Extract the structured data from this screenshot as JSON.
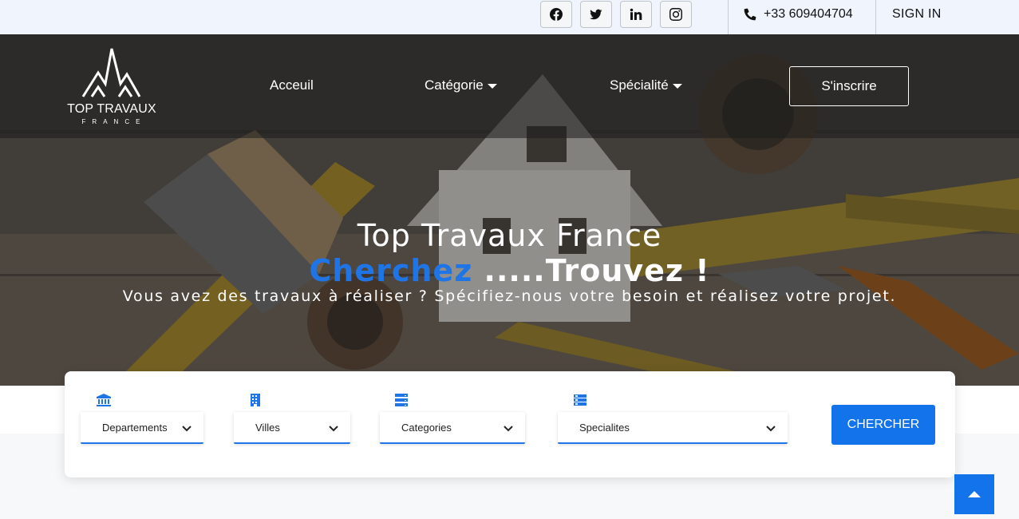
{
  "topbar": {
    "social": [
      {
        "name": "facebook-icon"
      },
      {
        "name": "twitter-icon"
      },
      {
        "name": "linkedin-icon"
      },
      {
        "name": "instagram-icon"
      }
    ],
    "phone": "+33 609404704",
    "signin": "SIGN IN"
  },
  "logo": {
    "main": "TOP TRAVAUX",
    "sub": "FRANCE"
  },
  "nav": {
    "home": "Acceuil",
    "category": "Catégorie",
    "specialty": "Spécialité",
    "signup": "S'inscrire"
  },
  "hero": {
    "title": "Top Travaux France",
    "tag_blue": "Cherchez",
    "tag_white": " .....Trouvez !",
    "subtitle": "Vous avez des travaux à réaliser ? Spécifiez-nous votre besoin et réalisez votre projet."
  },
  "search": {
    "departements": "Departements",
    "villes": "Villes",
    "categories": "Categories",
    "specialites": "Specialites",
    "button": "CHERCHER"
  },
  "colors": {
    "accent": "#1273eb",
    "topbar_bg": "#f0f5fd"
  }
}
